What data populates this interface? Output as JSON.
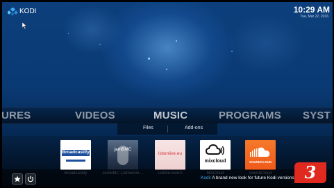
{
  "app": {
    "name": "KODI"
  },
  "status": {
    "time": "10:29 AM",
    "date": "Tue, Mar 22, 2016"
  },
  "main_menu": {
    "items": [
      {
        "label": "URES"
      },
      {
        "label": "VIDEOS"
      },
      {
        "label": "MUSIC"
      },
      {
        "label": "PROGRAMS"
      },
      {
        "label": "SYST"
      }
    ],
    "selected": "MUSIC"
  },
  "submenu": {
    "items": [
      {
        "label": "Files"
      },
      {
        "label": "Add-ons"
      }
    ]
  },
  "addons": [
    {
      "name": "Broadcastify",
      "tile_text": "Broadcastify",
      "color": "#ffffff"
    },
    {
      "name": "JamBMC (Jamendo ...",
      "tile_text": "jamBMC",
      "color": "#3b4d66"
    },
    {
      "name": "ListenLiveEU",
      "tile_text": "listenlive.eu",
      "color": "#f3d9d9"
    },
    {
      "name": "MixCloud",
      "tile_text": "mixcloud",
      "color": "#ffffff"
    },
    {
      "name": "SoundCloud",
      "tile_text": "SOUNDCLOUD",
      "color": "#f26f23"
    }
  ],
  "ticker": {
    "source": "Kodi",
    "message": ": A brand new look for future Kodi versions"
  },
  "badge": {
    "text": "3",
    "color": "#e02a1f"
  },
  "icons": [
    "kodi-logo-icon",
    "cursor-icon",
    "favourites-star-icon",
    "power-icon"
  ]
}
